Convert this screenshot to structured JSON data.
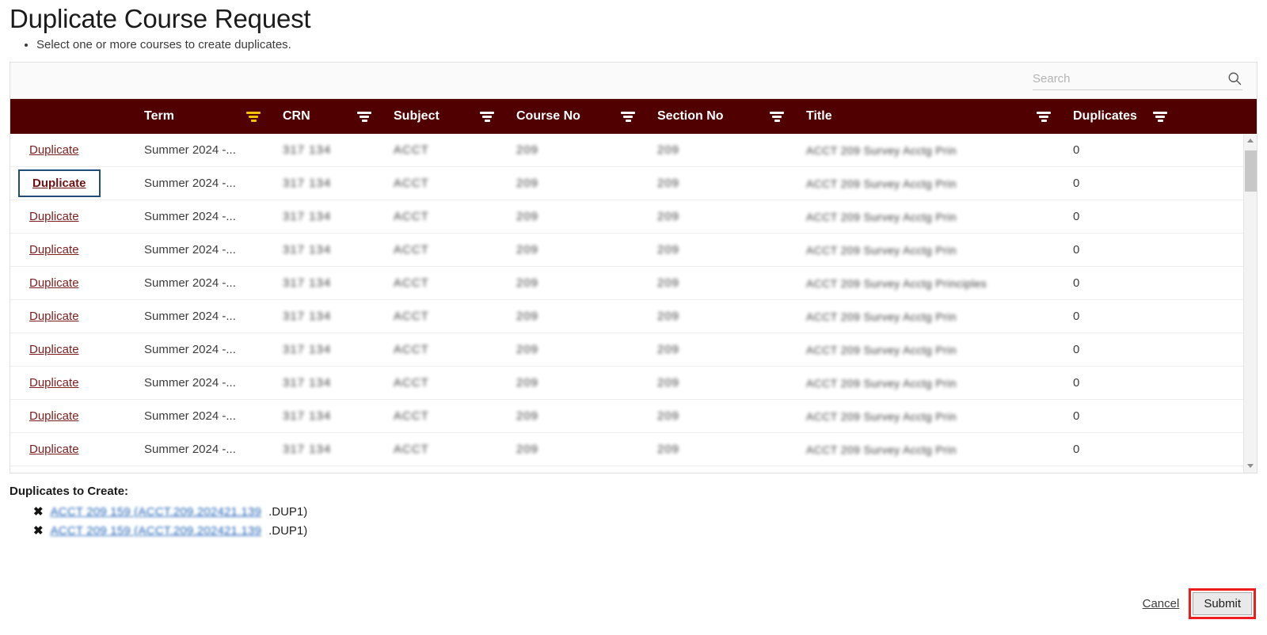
{
  "page": {
    "title": "Duplicate Course Request",
    "instructions": [
      "Select one or more courses to create duplicates."
    ]
  },
  "colors": {
    "header_bar": "#500000",
    "link": "#7c1d1d",
    "active_filter": "#f2c200",
    "focus_outline": "#1f4e79",
    "highlight": "#ee1c1c",
    "entry_link": "#1f63b5"
  },
  "search": {
    "placeholder": "Search",
    "value": "",
    "icon": "search-icon"
  },
  "table": {
    "columns": [
      {
        "key": "action",
        "label": "",
        "filter": false,
        "filter_active": false
      },
      {
        "key": "term",
        "label": "Term",
        "filter": true,
        "filter_active": true
      },
      {
        "key": "crn",
        "label": "CRN",
        "filter": true,
        "filter_active": false
      },
      {
        "key": "subject",
        "label": "Subject",
        "filter": true,
        "filter_active": false
      },
      {
        "key": "courseno",
        "label": "Course No",
        "filter": true,
        "filter_active": false
      },
      {
        "key": "sectionno",
        "label": "Section No",
        "filter": true,
        "filter_active": false
      },
      {
        "key": "title",
        "label": "Title",
        "filter": true,
        "filter_active": false
      },
      {
        "key": "duplicates",
        "label": "Duplicates",
        "filter": true,
        "filter_active": false
      }
    ],
    "action_label": "Duplicate",
    "rows": [
      {
        "term": "Summer 2024 -...",
        "crn": "317 134",
        "subject": "ACCT",
        "courseno": "209",
        "sectionno": "209",
        "title": "ACCT 209 Survey Acctg Prin",
        "duplicates": "0",
        "focused": false,
        "redacted": true
      },
      {
        "term": "Summer 2024 -...",
        "crn": "317 134",
        "subject": "ACCT",
        "courseno": "209",
        "sectionno": "209",
        "title": "ACCT 209 Survey Acctg Prin",
        "duplicates": "0",
        "focused": true,
        "redacted": true
      },
      {
        "term": "Summer 2024 -...",
        "crn": "317 134",
        "subject": "ACCT",
        "courseno": "209",
        "sectionno": "209",
        "title": "ACCT 209 Survey Acctg Prin",
        "duplicates": "0",
        "focused": false,
        "redacted": true
      },
      {
        "term": "Summer 2024 -...",
        "crn": "317 134",
        "subject": "ACCT",
        "courseno": "209",
        "sectionno": "209",
        "title": "ACCT 209 Survey Acctg Prin",
        "duplicates": "0",
        "focused": false,
        "redacted": true
      },
      {
        "term": "Summer 2024 -...",
        "crn": "317 134",
        "subject": "ACCT",
        "courseno": "209",
        "sectionno": "209",
        "title": "ACCT 209 Survey Acctg Principles",
        "duplicates": "0",
        "focused": false,
        "redacted": true
      },
      {
        "term": "Summer 2024 -...",
        "crn": "317 134",
        "subject": "ACCT",
        "courseno": "209",
        "sectionno": "209",
        "title": "ACCT 209 Survey Acctg Prin",
        "duplicates": "0",
        "focused": false,
        "redacted": true
      },
      {
        "term": "Summer 2024 -...",
        "crn": "317 134",
        "subject": "ACCT",
        "courseno": "209",
        "sectionno": "209",
        "title": "ACCT 209 Survey Acctg Prin",
        "duplicates": "0",
        "focused": false,
        "redacted": true
      },
      {
        "term": "Summer 2024 -...",
        "crn": "317 134",
        "subject": "ACCT",
        "courseno": "209",
        "sectionno": "209",
        "title": "ACCT 209 Survey Acctg Prin",
        "duplicates": "0",
        "focused": false,
        "redacted": true
      },
      {
        "term": "Summer 2024 -...",
        "crn": "317 134",
        "subject": "ACCT",
        "courseno": "209",
        "sectionno": "209",
        "title": "ACCT 209 Survey Acctg Prin",
        "duplicates": "0",
        "focused": false,
        "redacted": true
      },
      {
        "term": "Summer 2024 -...",
        "crn": "317 134",
        "subject": "ACCT",
        "courseno": "209",
        "sectionno": "209",
        "title": "ACCT 209 Survey Acctg Prin",
        "duplicates": "0",
        "focused": false,
        "redacted": true
      }
    ],
    "scrollbar": {
      "visible": true,
      "thumb_position_pct": 2
    }
  },
  "duplicates_to_create": {
    "title": "Duplicates to Create:",
    "remove_icon": "x-icon",
    "items": [
      {
        "link": "ACCT 209 159 (ACCT.209.202421.139",
        "tail": ".DUP1)"
      },
      {
        "link": "ACCT 209 159 (ACCT.209.202421.139",
        "tail": ".DUP1)"
      }
    ]
  },
  "actions": {
    "cancel_label": "Cancel",
    "submit_label": "Submit",
    "submit_highlighted": true
  }
}
